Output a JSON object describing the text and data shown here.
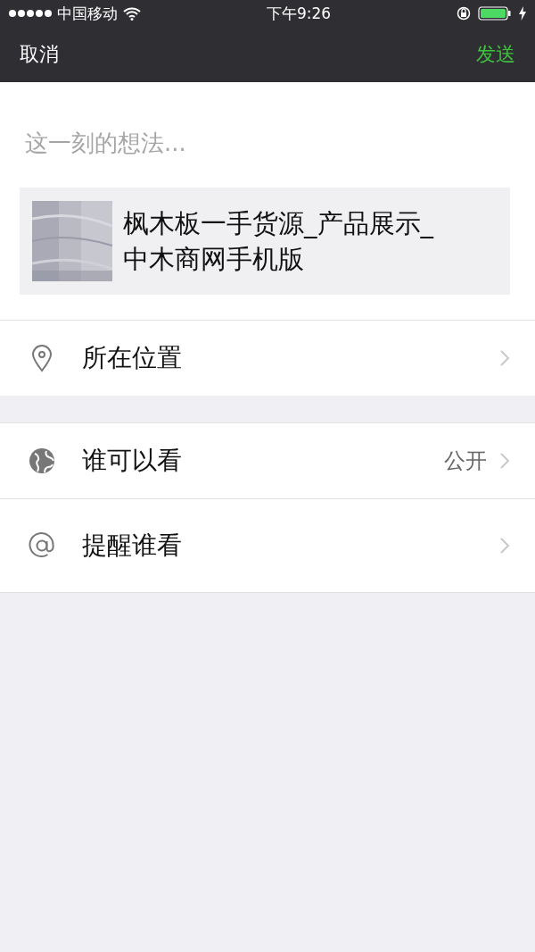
{
  "status_bar": {
    "carrier": "中国移动",
    "time": "下午9:26"
  },
  "nav": {
    "cancel": "取消",
    "send": "发送"
  },
  "composer": {
    "placeholder": "这一刻的想法..."
  },
  "link_card": {
    "title": "枫木板一手货源_产品展示_中木商网手机版"
  },
  "location": {
    "label": "所在位置"
  },
  "options": [
    {
      "kind": "globe",
      "label": "谁可以看",
      "value": "公开"
    },
    {
      "kind": "at",
      "label": "提醒谁看"
    }
  ]
}
